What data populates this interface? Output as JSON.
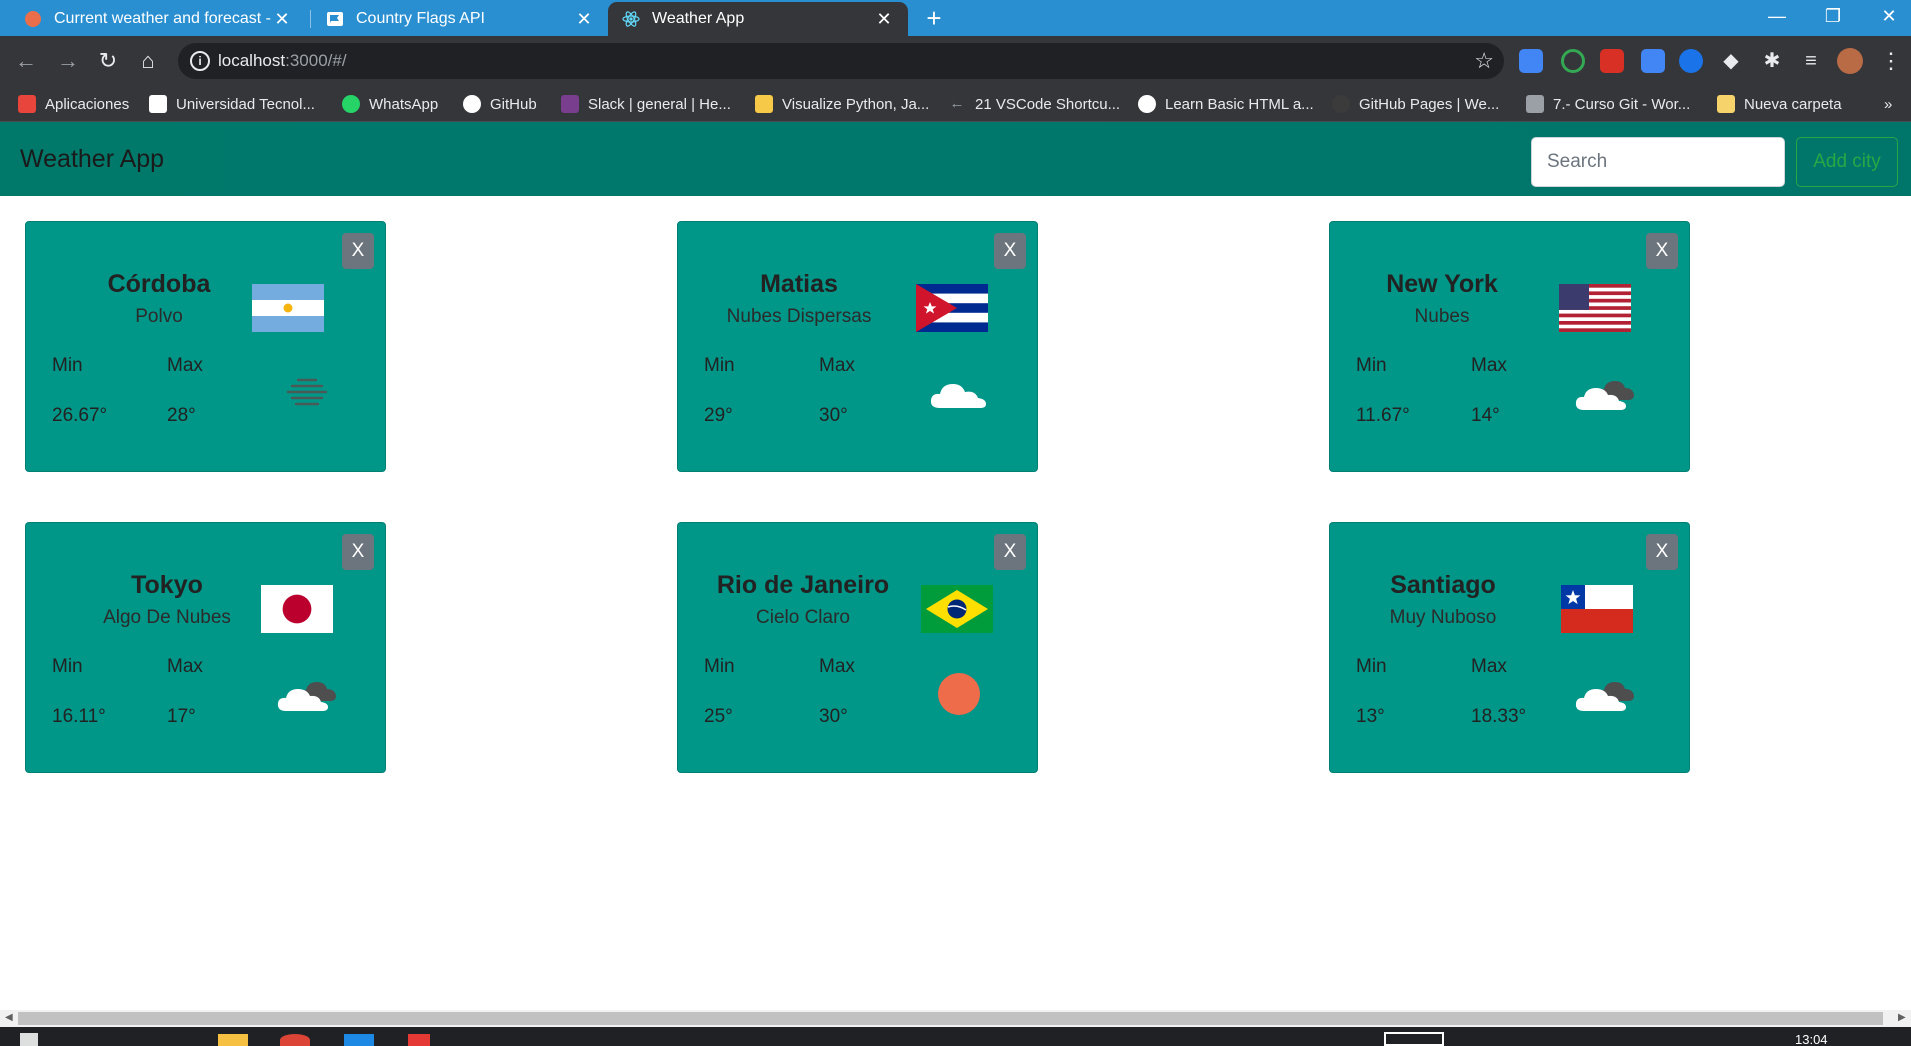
{
  "browser": {
    "tabs": [
      {
        "title": "Current weather and forecast - O"
      },
      {
        "title": "Country Flags API"
      },
      {
        "title": "Weather App"
      }
    ],
    "address": {
      "host": "localhost",
      "rest": ":3000/#/"
    },
    "bookmarks": [
      {
        "label": "Aplicaciones",
        "color": "#e8453c"
      },
      {
        "label": "Universidad Tecnol...",
        "color": "#ffffff"
      },
      {
        "label": "WhatsApp",
        "color": "#25d366"
      },
      {
        "label": "GitHub",
        "color": "#ffffff"
      },
      {
        "label": "Slack | general | He...",
        "color": "#7a3e8f"
      },
      {
        "label": "Visualize Python, Ja...",
        "color": "#f7c948"
      },
      {
        "label": "21 VSCode Shortcu...",
        "color": "#9aa0a6"
      },
      {
        "label": "Learn Basic HTML a...",
        "color": "#ffffff"
      },
      {
        "label": "GitHub Pages | We...",
        "color": "#3b3b3b"
      },
      {
        "label": "7.- Curso Git - Wor...",
        "color": "#9aa0a6"
      },
      {
        "label": "Nueva carpeta",
        "color": "#f6d36b"
      }
    ],
    "clock": "13:04"
  },
  "app": {
    "brand": "Weather App",
    "search_placeholder": "Search",
    "add_city_label": "Add city",
    "close_label": "X",
    "min_label": "Min",
    "max_label": "Max"
  },
  "cards": [
    {
      "city": "Córdoba",
      "desc": "Polvo",
      "min": "26.67°",
      "max": "28°",
      "flag": "argentina-flag",
      "weather": "mist-icon"
    },
    {
      "city": "Matias",
      "desc": "Nubes Dispersas",
      "min": "29°",
      "max": "30°",
      "flag": "cuba-flag",
      "weather": "cloud-icon"
    },
    {
      "city": "New York",
      "desc": "Nubes",
      "min": "11.67°",
      "max": "14°",
      "flag": "usa-flag",
      "weather": "clouds-icon"
    },
    {
      "city": "Tokyo",
      "desc": "Algo De Nubes",
      "min": "16.11°",
      "max": "17°",
      "flag": "japan-flag",
      "weather": "clouds-icon"
    },
    {
      "city": "Rio de Janeiro",
      "desc": "Cielo Claro",
      "min": "25°",
      "max": "30°",
      "flag": "brazil-flag",
      "weather": "sun-icon"
    },
    {
      "city": "Santiago",
      "desc": "Muy Nuboso",
      "min": "13°",
      "max": "18.33°",
      "flag": "chile-flag",
      "weather": "clouds-icon"
    }
  ],
  "colors": {
    "tabstrip": "#2a8fd1",
    "chrome": "#35363a",
    "navbar": "#00796b",
    "card": "#009688",
    "close_button": "#6c757d",
    "add_city": "#28a745",
    "sun": "#ef6c4b"
  }
}
